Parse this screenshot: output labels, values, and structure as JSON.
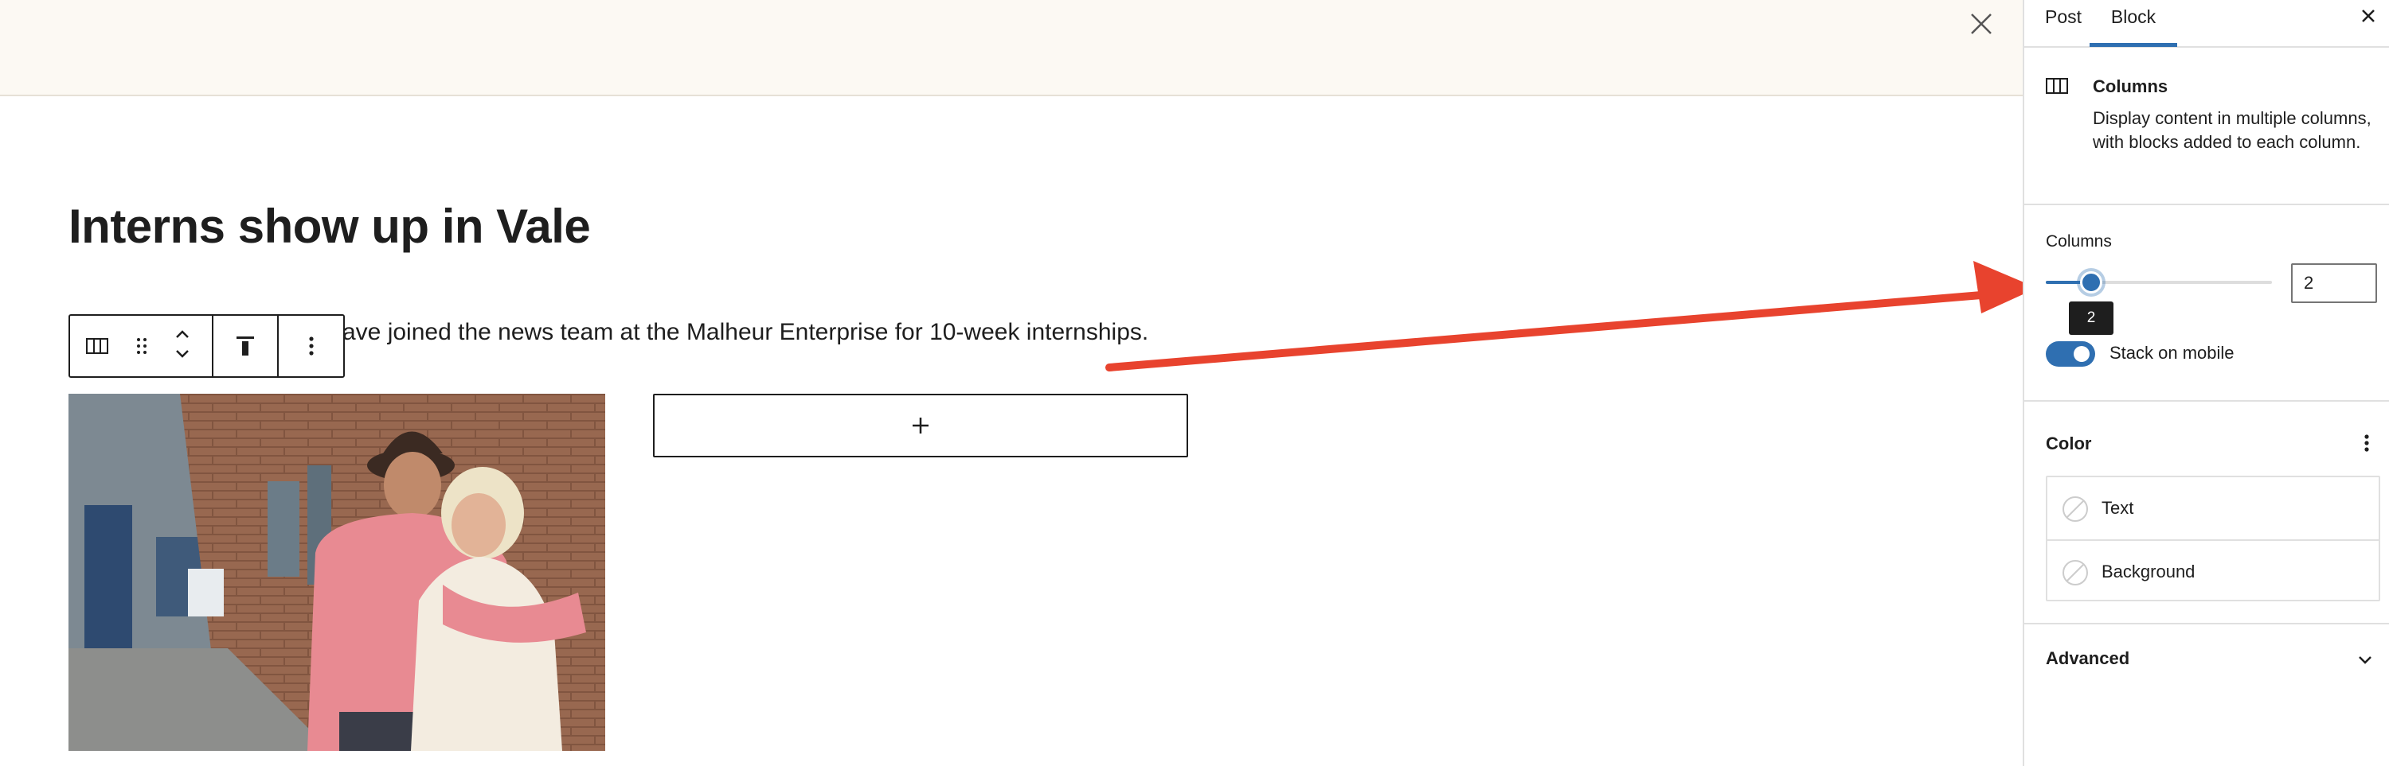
{
  "editor": {
    "post_title": "Interns show up in Vale",
    "paragraph_visible": "ave joined the news team at the Malheur Enterprise for 10-week internships.",
    "appender_symbol": "+"
  },
  "sidebar": {
    "tabs": [
      {
        "label": "Post",
        "active": false
      },
      {
        "label": "Block",
        "active": true
      }
    ],
    "block_card": {
      "title": "Columns",
      "description": "Display content in multiple columns, with blocks added to each column."
    },
    "settings": {
      "columns_label": "Columns",
      "columns_value": "2",
      "columns_min": 1,
      "columns_max": 6,
      "tooltip": "2",
      "stack_on_mobile_label": "Stack on mobile",
      "stack_on_mobile": true
    },
    "color": {
      "title": "Color",
      "items": [
        {
          "label": "Text"
        },
        {
          "label": "Background"
        }
      ]
    },
    "advanced": {
      "title": "Advanced"
    }
  },
  "colors": {
    "accent": "#2f6fb1",
    "annotation_arrow": "#e8432e",
    "banner": "#fcf9f3"
  }
}
